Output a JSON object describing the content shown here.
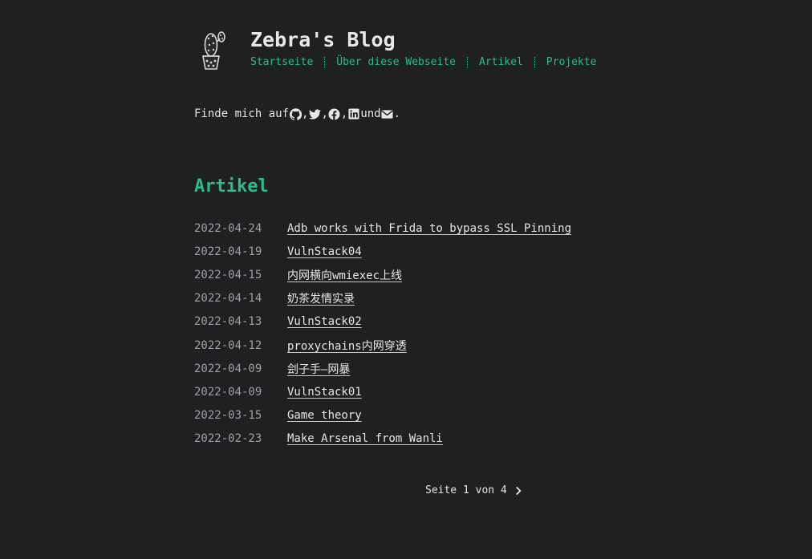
{
  "site": {
    "title": "Zebra's Blog"
  },
  "nav": {
    "items": [
      "Startseite",
      "Über diese Webseite",
      "Artikel",
      "Projekte"
    ]
  },
  "social": {
    "prefix": "Finde mich auf",
    "comma": ",",
    "and": "und",
    "period": ".",
    "icons": [
      "github-icon",
      "twitter-icon",
      "facebook-icon",
      "linkedin-icon",
      "envelope-icon"
    ]
  },
  "section": {
    "title": "Artikel"
  },
  "posts": [
    {
      "date": "2022-04-24",
      "title": "Adb works with Frida to bypass SSL Pinning"
    },
    {
      "date": "2022-04-19",
      "title": "VulnStack04"
    },
    {
      "date": "2022-04-15",
      "title": "内网横向wmiexec上线"
    },
    {
      "date": "2022-04-14",
      "title": "奶茶发情实录"
    },
    {
      "date": "2022-04-13",
      "title": "VulnStack02"
    },
    {
      "date": "2022-04-12",
      "title": "proxychains内网穿透"
    },
    {
      "date": "2022-04-09",
      "title": "刽子手—网暴"
    },
    {
      "date": "2022-04-09",
      "title": "VulnStack01"
    },
    {
      "date": "2022-03-15",
      "title": "Game theory"
    },
    {
      "date": "2022-02-23",
      "title": "Make Arsenal from Wanli"
    }
  ],
  "pagination": {
    "text": "Seite 1 von 4"
  },
  "colors": {
    "background": "#1f2022",
    "accent": "#2bbc8a",
    "text": "#e6e6e6",
    "muted": "#9ea0a3"
  }
}
